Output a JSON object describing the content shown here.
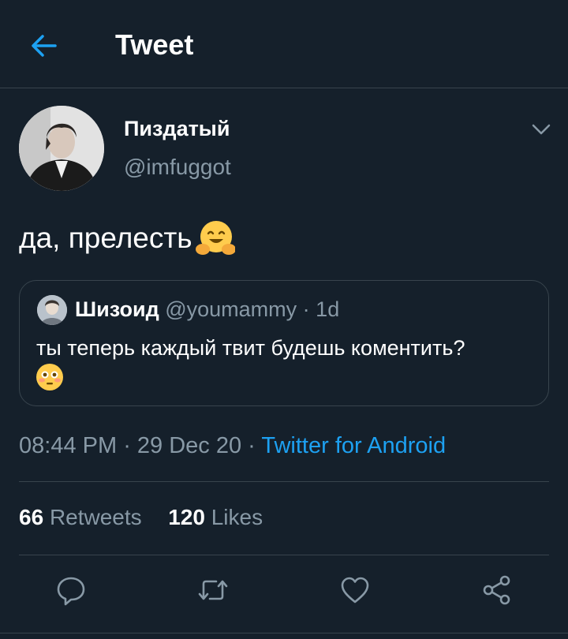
{
  "header": {
    "title": "Tweet"
  },
  "tweet": {
    "display_name": "Пиздатый",
    "handle": "@imfuggot",
    "text": "да, прелесть",
    "time": "08:44 PM",
    "date": "29 Dec 20",
    "source": "Twitter for Android"
  },
  "quoted": {
    "name": "Шизоид",
    "handle": "@youmammy",
    "sep": " · ",
    "age": "1d",
    "text": "ты теперь каждый твит будешь коментить?"
  },
  "stats": {
    "retweets_count": "66",
    "retweets_label": "Retweets",
    "likes_count": "120",
    "likes_label": "Likes"
  },
  "meta_sep": " · ",
  "icons": {
    "back": "arrow-left-icon",
    "more": "chevron-down-icon",
    "reply": "reply-icon",
    "retweet": "retweet-icon",
    "like": "heart-icon",
    "share": "share-icon"
  },
  "colors": {
    "background": "#15202b",
    "accent": "#1da1f2",
    "secondary_text": "#8899a6",
    "border": "#38444d"
  }
}
